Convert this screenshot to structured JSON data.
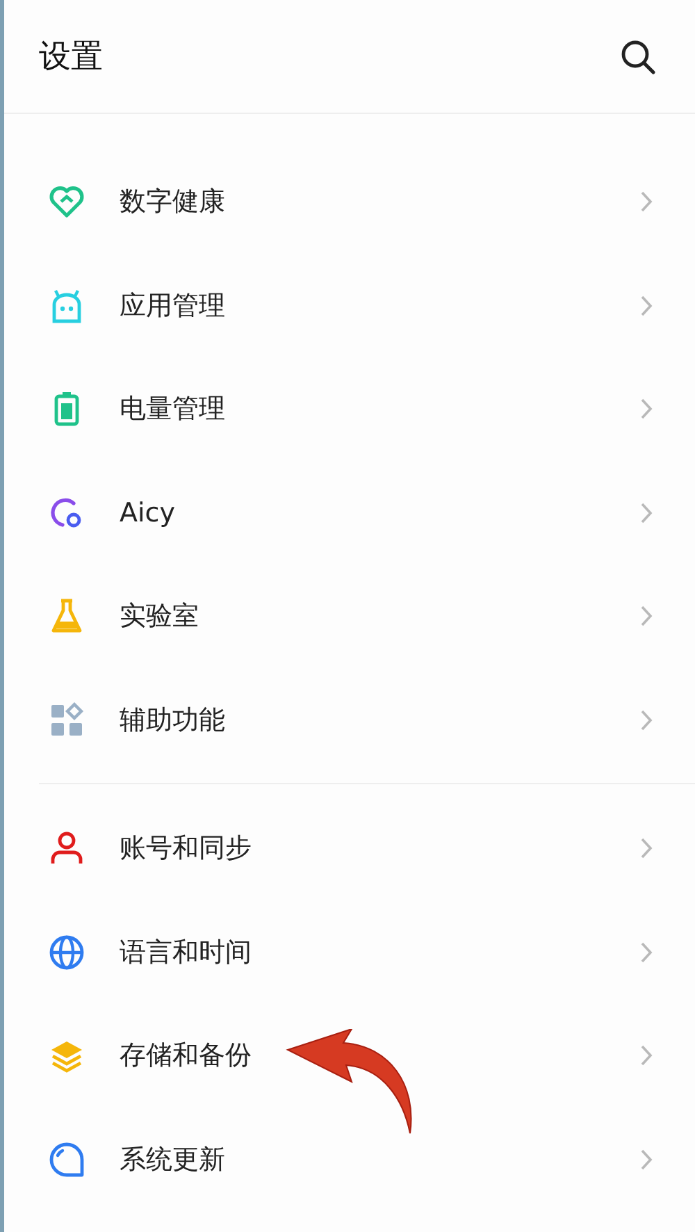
{
  "header": {
    "title": "设置"
  },
  "groups": [
    {
      "items": [
        {
          "label": "数字健康",
          "kind": "heart"
        },
        {
          "label": "应用管理",
          "kind": "robot"
        },
        {
          "label": "电量管理",
          "kind": "battery"
        },
        {
          "label": "Aicy",
          "kind": "aicy"
        },
        {
          "label": "实验室",
          "kind": "flask"
        },
        {
          "label": "辅助功能",
          "kind": "grid"
        }
      ]
    },
    {
      "items": [
        {
          "label": "账号和同步",
          "kind": "person"
        },
        {
          "label": "语言和时间",
          "kind": "globe"
        },
        {
          "label": "存储和备份",
          "kind": "layers"
        },
        {
          "label": "系统更新",
          "kind": "update"
        }
      ]
    }
  ]
}
